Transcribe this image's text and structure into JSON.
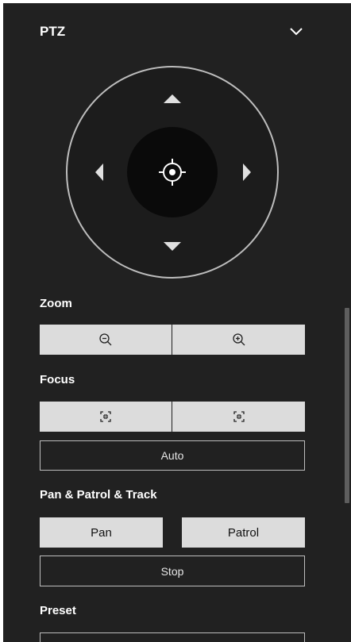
{
  "header": {
    "title": "PTZ",
    "collapse_icon": "chevron-down-icon"
  },
  "ptz_control": {
    "icons": {
      "up": "arrow-up-icon",
      "down": "arrow-down-icon",
      "left": "arrow-left-icon",
      "right": "arrow-right-icon",
      "center": "crosshair-icon"
    }
  },
  "zoom": {
    "label": "Zoom",
    "zoom_out_icon": "zoom-out-icon",
    "zoom_in_icon": "zoom-in-icon"
  },
  "focus": {
    "label": "Focus",
    "focus_near_icon": "focus-near-icon",
    "focus_far_icon": "focus-far-icon",
    "auto_label": "Auto"
  },
  "pan_patrol_track": {
    "label": "Pan & Patrol & Track",
    "pan_label": "Pan",
    "patrol_label": "Patrol",
    "stop_label": "Stop"
  },
  "preset": {
    "label": "Preset"
  },
  "colors": {
    "panel_bg": "#212121",
    "button_light": "#dcdcdc",
    "ring": "#bdbdbd",
    "joystick_inner": "#0a0a0a"
  }
}
